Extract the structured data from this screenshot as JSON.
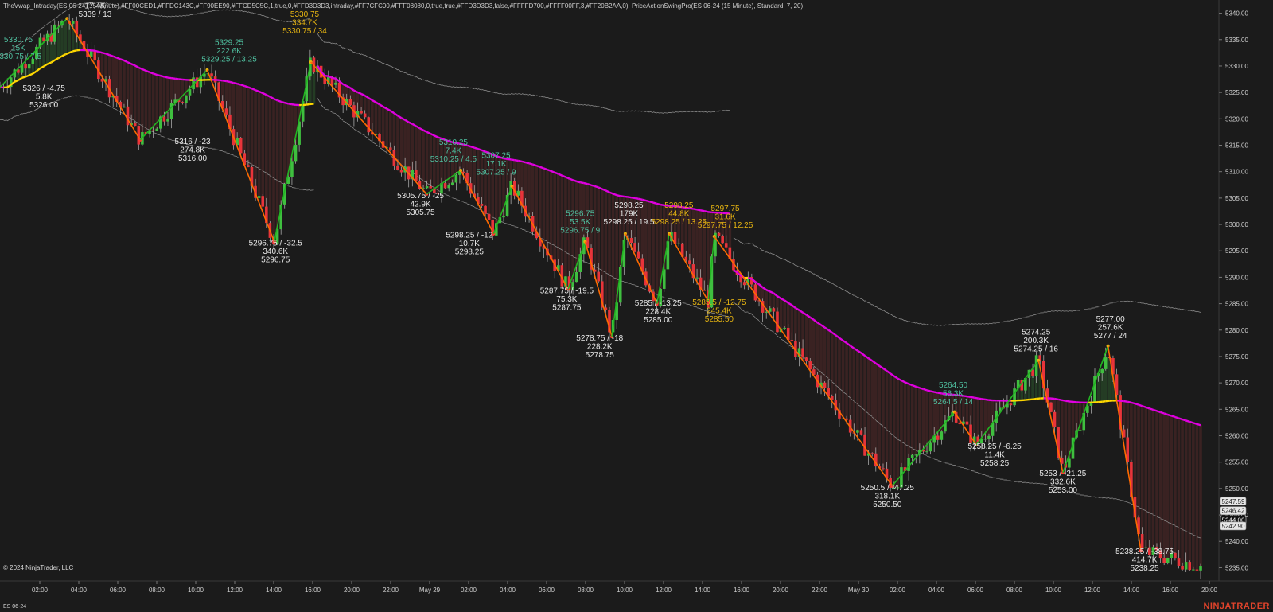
{
  "header": {
    "indicators": "TheVwap_Intraday(ES 06-24 (15 Minute),#FF00CED1,#FFDC143C,#FF90EE90,#FFCD5C5C,1,true,0,#FFD3D3D3,intraday,#FF7CFC00,#FFF08080,0,true,true,#FFD3D3D3,false,#FFFFD700,#FFFF00FF,3,#FF20B2AA,0),  PriceActionSwingPro(ES 06-24 (15 Minute), Standard, 7, 20)"
  },
  "footer": {
    "copyright": "© 2024 NinjaTrader, LLC",
    "instrument": "ES 06-24",
    "brand": "NINJATRADER"
  },
  "colors": {
    "background": "#1b1b1b",
    "up_candle": "#3fbf3f",
    "down_candle": "#e8343a",
    "vwap_below": "#e000e0",
    "vwap_above": "#ffd700",
    "band": "#8c8c8c",
    "swing_down": "#ff6a00",
    "swing_up": "#22b522",
    "label_white": "#e8e8e8",
    "label_teal": "#4fbf9f",
    "label_gold": "#e7b511"
  },
  "chart_data": {
    "type": "candlestick",
    "instrument": "ES 06-24",
    "interval": "15 Minute",
    "ylim": [
      5232.5,
      5342.5
    ],
    "y_ticks": [
      "5340.00",
      "5335.00",
      "5330.00",
      "5325.00",
      "5320.00",
      "5315.00",
      "5310.00",
      "5305.00",
      "5300.00",
      "5295.00",
      "5290.00",
      "5285.00",
      "5280.00",
      "5275.00",
      "5270.00",
      "5265.00",
      "5260.00",
      "5255.00",
      "5250.00",
      "5245.00",
      "5240.00",
      "5235.00"
    ],
    "x_ticks": [
      "02:00",
      "04:00",
      "06:00",
      "08:00",
      "10:00",
      "12:00",
      "14:00",
      "16:00",
      "20:00",
      "22:00",
      "May 29",
      "02:00",
      "04:00",
      "06:00",
      "08:00",
      "10:00",
      "12:00",
      "14:00",
      "16:00",
      "20:00",
      "22:00",
      "May 30",
      "02:00",
      "04:00",
      "06:00",
      "08:00",
      "10:00",
      "12:00",
      "14:00",
      "16:00",
      "20:00"
    ],
    "price_markers": [
      {
        "value": "5247.59",
        "style": "light"
      },
      {
        "value": "5246.42",
        "style": "light"
      },
      {
        "value": "5244.00",
        "style": "dark"
      },
      {
        "value": "5242.90",
        "style": "light"
      }
    ],
    "swing_path": [
      {
        "t": 0,
        "p": 5326.0
      },
      {
        "t": 0.055,
        "p": 5339.0
      },
      {
        "t": 0.115,
        "p": 5316.0
      },
      {
        "t": 0.17,
        "p": 5329.25
      },
      {
        "t": 0.225,
        "p": 5296.75
      },
      {
        "t": 0.255,
        "p": 5330.75
      },
      {
        "t": 0.35,
        "p": 5305.75
      },
      {
        "t": 0.378,
        "p": 5310.25
      },
      {
        "t": 0.405,
        "p": 5298.25
      },
      {
        "t": 0.42,
        "p": 5307.25
      },
      {
        "t": 0.466,
        "p": 5287.75
      },
      {
        "t": 0.48,
        "p": 5296.75
      },
      {
        "t": 0.502,
        "p": 5278.75
      },
      {
        "t": 0.513,
        "p": 5298.25
      },
      {
        "t": 0.539,
        "p": 5285.0
      },
      {
        "t": 0.549,
        "p": 5298.25
      },
      {
        "t": 0.581,
        "p": 5285.5
      },
      {
        "t": 0.586,
        "p": 5297.75
      },
      {
        "t": 0.732,
        "p": 5250.5
      },
      {
        "t": 0.783,
        "p": 5264.5
      },
      {
        "t": 0.801,
        "p": 5258.25
      },
      {
        "t": 0.852,
        "p": 5274.25
      },
      {
        "t": 0.872,
        "p": 5253.0
      },
      {
        "t": 0.909,
        "p": 5277.0
      },
      {
        "t": 0.936,
        "p": 5238.25
      }
    ],
    "swing_labels": [
      {
        "lines": [
          "5330.75",
          "15K",
          "5330.75 / 7.5"
        ],
        "color": "teal",
        "t": 0.015,
        "p": 5334.5
      },
      {
        "lines": [
          "5339.00",
          "17.4K",
          "5339 / 13"
        ],
        "color": "white",
        "t": 0.078,
        "p": 5342.5
      },
      {
        "lines": [
          "5326 / -4.75",
          "5.8K",
          "5326.00"
        ],
        "color": "white",
        "t": 0.036,
        "p": 5325.3
      },
      {
        "lines": [
          "5329.25",
          "222.6K",
          "5329.25 / 13.25"
        ],
        "color": "teal",
        "t": 0.188,
        "p": 5334.0
      },
      {
        "lines": [
          "5316 / -23",
          "274.8K",
          "5316.00"
        ],
        "color": "white",
        "t": 0.158,
        "p": 5315.2
      },
      {
        "lines": [
          "5330.75",
          "334.7K",
          "5330.75 / 34"
        ],
        "color": "gold",
        "t": 0.25,
        "p": 5339.3
      },
      {
        "lines": [
          "5296.75 / -32.5",
          "340.6K",
          "5296.75"
        ],
        "color": "white",
        "t": 0.226,
        "p": 5296.0
      },
      {
        "lines": [
          "5310.25",
          "7.4K",
          "5310.25 / 4.5"
        ],
        "color": "teal",
        "t": 0.372,
        "p": 5315.1
      },
      {
        "lines": [
          "5307.25",
          "17.1K",
          "5307.25 / 9"
        ],
        "color": "teal",
        "t": 0.407,
        "p": 5312.6
      },
      {
        "lines": [
          "5305.75 / -25",
          "42.9K",
          "5305.75"
        ],
        "color": "white",
        "t": 0.345,
        "p": 5305.0
      },
      {
        "lines": [
          "5298.25 / -12",
          "10.7K",
          "5298.25"
        ],
        "color": "white",
        "t": 0.385,
        "p": 5297.5
      },
      {
        "lines": [
          "5296.75",
          "53.5K",
          "5296.75 / 9"
        ],
        "color": "teal",
        "t": 0.476,
        "p": 5301.6
      },
      {
        "lines": [
          "5298.25",
          "179K",
          "5298.25 / 19.5"
        ],
        "color": "white",
        "t": 0.516,
        "p": 5303.2
      },
      {
        "lines": [
          "5298.25",
          "44.8K",
          "5298.25 / 13.25"
        ],
        "color": "gold",
        "t": 0.557,
        "p": 5303.2
      },
      {
        "lines": [
          "5297.75",
          "31.6K",
          "5297.75 / 12.25"
        ],
        "color": "gold",
        "t": 0.595,
        "p": 5302.6
      },
      {
        "lines": [
          "5287.75 / -19.5",
          "75.3K",
          "5287.75"
        ],
        "color": "white",
        "t": 0.465,
        "p": 5287.0
      },
      {
        "lines": [
          "5285 / -13.25",
          "228.4K",
          "5285.00"
        ],
        "color": "white",
        "t": 0.54,
        "p": 5284.6
      },
      {
        "lines": [
          "5285.5 / -12.75",
          "245.4K",
          "5285.50"
        ],
        "color": "gold",
        "t": 0.59,
        "p": 5284.8
      },
      {
        "lines": [
          "5278.75 / -18",
          "228.2K",
          "5278.75"
        ],
        "color": "white",
        "t": 0.492,
        "p": 5278.0
      },
      {
        "lines": [
          "5274.25",
          "200.3K",
          "5274.25 / 16"
        ],
        "color": "white",
        "t": 0.85,
        "p": 5279.1
      },
      {
        "lines": [
          "5277.00",
          "257.6K",
          "5277 / 24"
        ],
        "color": "white",
        "t": 0.911,
        "p": 5281.6
      },
      {
        "lines": [
          "5264.50",
          "56.3K",
          "5264.5 / 14"
        ],
        "color": "teal",
        "t": 0.782,
        "p": 5269.1
      },
      {
        "lines": [
          "5258.25 / -6.25",
          "11.4K",
          "5258.25"
        ],
        "color": "white",
        "t": 0.816,
        "p": 5257.5
      },
      {
        "lines": [
          "5253 / -21.25",
          "332.6K",
          "5253.00"
        ],
        "color": "white",
        "t": 0.872,
        "p": 5252.4
      },
      {
        "lines": [
          "5250.5 / -47.25",
          "318.1K",
          "5250.50"
        ],
        "color": "white",
        "t": 0.728,
        "p": 5249.7
      },
      {
        "lines": [
          "5238.25 / -38.75",
          "414.7K",
          "5238.25"
        ],
        "color": "white",
        "t": 0.939,
        "p": 5237.6
      }
    ]
  }
}
